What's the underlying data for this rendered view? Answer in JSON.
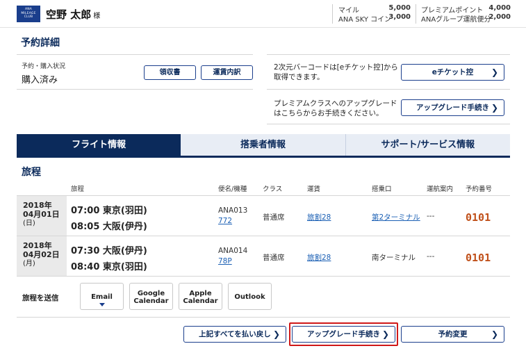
{
  "header": {
    "logo_lines": [
      "ANA",
      "MILEAGE",
      "CLUB"
    ],
    "user_name": "空野 太郎",
    "user_suffix": "様",
    "stats": [
      {
        "label": "マイル",
        "value": "5,000"
      },
      {
        "label": "ANA SKY コイン",
        "value": "3,000"
      },
      {
        "label": "プレミアムポイント",
        "value": "4,000"
      },
      {
        "label": "ANAグループ運航便分",
        "value": "2,000"
      }
    ]
  },
  "booking": {
    "title": "予約詳細",
    "status_label": "予約・購入状況",
    "status_value": "購入済み",
    "receipt_button": "領収書",
    "fare_button": "運賃内訳",
    "eticket_note_line1": "2次元バーコードは[eチケット控]から",
    "eticket_note_line2": "取得できます。",
    "eticket_button": "eチケット控",
    "upgrade_note_line1": "プレミアムクラスへのアップグレード",
    "upgrade_note_line2": "はこちらからお手続きください。",
    "upgrade_button": "アップグレード手続き"
  },
  "tabs": [
    "フライト情報",
    "搭乗者情報",
    "サポート/サービス情報"
  ],
  "itinerary": {
    "title": "旅程",
    "columns": [
      "旅程",
      "便名/機種",
      "クラス",
      "運賃",
      "搭乗口",
      "運航案内",
      "予約番号"
    ],
    "flights": [
      {
        "year": "2018年",
        "date": "04月01日",
        "dow": "(日)",
        "dep": "07:00  東京(羽田)",
        "arr": "08:05  大阪(伊丹)",
        "flight_no": "ANA013",
        "aircraft": "772",
        "class": "普通席",
        "fare": "旅割28",
        "gate": "第2ターミナル",
        "ops": "---",
        "reservation": "0101"
      },
      {
        "year": "2018年",
        "date": "04月02日",
        "dow": "(月)",
        "dep": "07:30  大阪(伊丹)",
        "arr": "08:40  東京(羽田)",
        "flight_no": "ANA014",
        "aircraft": "78P",
        "class": "普通席",
        "fare": "旅割28",
        "gate": "南ターミナル",
        "ops": "---",
        "reservation": "0101"
      }
    ]
  },
  "send": {
    "label": "旅程を送信",
    "email": "Email",
    "google_line1": "Google",
    "google_line2": "Calendar",
    "apple_line1": "Apple",
    "apple_line2": "Calendar",
    "outlook": "Outlook"
  },
  "actions": {
    "refund": "上記すべてを払い戻し",
    "upgrade": "アップグレード手続き",
    "change": "予約変更"
  },
  "colors": {
    "brand": "#0b2a5b",
    "link": "#1a5fb4",
    "reservation": "#c0501a",
    "highlight": "#d01818"
  }
}
